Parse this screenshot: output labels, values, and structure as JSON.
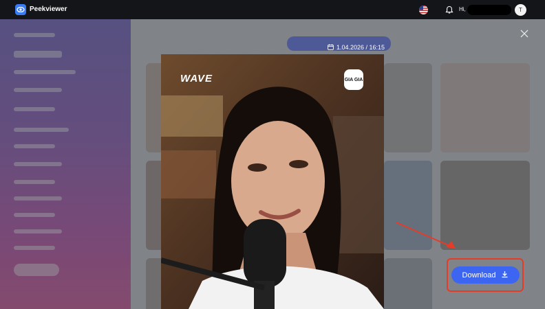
{
  "app": {
    "name": "Peekviewer"
  },
  "header": {
    "greeting": "Hi,",
    "avatar_initial": "T",
    "language_icon": "us-flag-icon",
    "notification_icon": "bell-icon"
  },
  "media": {
    "timestamp": "1.04.2026 / 16:15",
    "watermark_left": "WAVE",
    "watermark_right": "GIA GIA"
  },
  "actions": {
    "download_label": "Download",
    "download_icon": "download-icon",
    "close_icon": "close-icon"
  },
  "colors": {
    "accent": "#3c66f2",
    "annotation": "#e63c27",
    "topbar": "#141518"
  }
}
